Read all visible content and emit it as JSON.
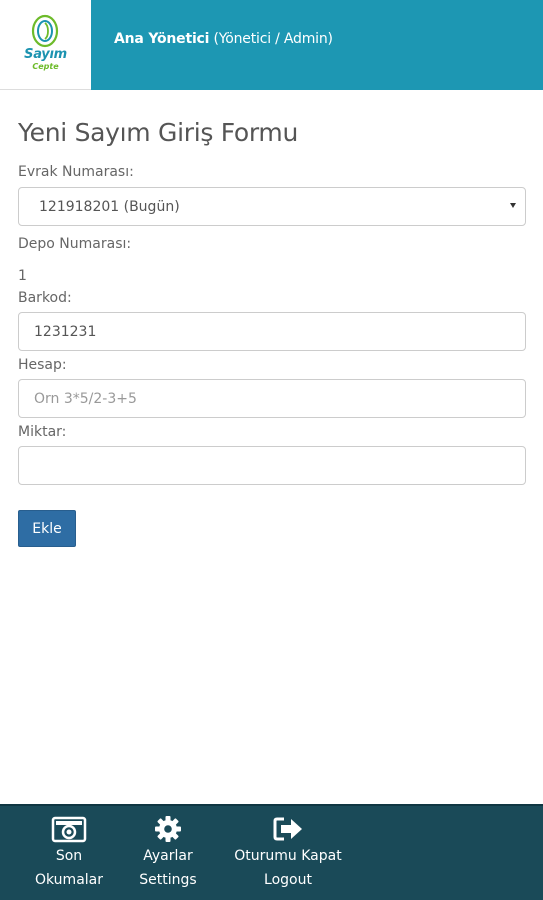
{
  "header": {
    "logo": {
      "name": "Sayım",
      "tagline": "Cepte"
    },
    "user_name_bold": "Ana Yönetici",
    "user_role": "(Yönetici / Admin)"
  },
  "form": {
    "title": "Yeni Sayım Giriş Formu",
    "document_label": "Evrak Numarası:",
    "document_selected": "121918201 (Bugün)",
    "depot_label": "Depo Numarası:",
    "depot_value": "1",
    "barcode_label": "Barkod:",
    "barcode_value": "1231231",
    "account_label": "Hesap:",
    "account_placeholder": "Örn 3*5/2-3+5",
    "quantity_label": "Miktar:",
    "quantity_value": "",
    "submit_label": "Ekle"
  },
  "nav": {
    "recent": {
      "line1": "Son",
      "line2": "Okumalar",
      "icon": "camera-icon"
    },
    "settings": {
      "line1": "Ayarlar",
      "line2": "Settings",
      "icon": "gear-icon"
    },
    "logout": {
      "line1": "Oturumu Kapat",
      "line2": "Logout",
      "icon": "logout-icon"
    }
  },
  "colors": {
    "header_bg": "#1d97b3",
    "footer_bg": "#1a4a58",
    "button_bg": "#2e6da4",
    "logo_blue": "#1c93b0",
    "logo_green": "#6dbb2a"
  }
}
